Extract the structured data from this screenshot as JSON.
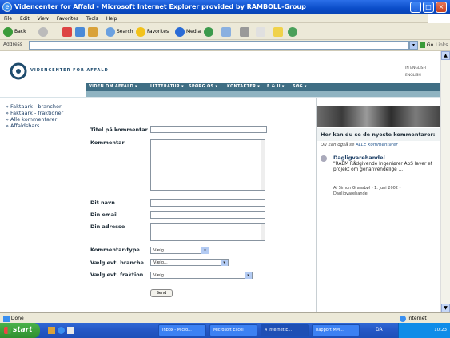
{
  "window": {
    "title": "Videncenter for Affald - Microsoft Internet Explorer provided by RAMBOLL-Group"
  },
  "menu": [
    "File",
    "Edit",
    "View",
    "Favorites",
    "Tools",
    "Help"
  ],
  "toolbar": {
    "back": "Back",
    "search": "Search",
    "favorites": "Favorites",
    "media": "Media"
  },
  "address": {
    "label": "Address",
    "go": "Go",
    "links": "Links"
  },
  "site": {
    "logo_text": "VIDENCENTER FOR AFFALD",
    "lang": [
      "IN ENGLISH",
      "ENGLISH"
    ],
    "nav": [
      "VIDEN OM AFFALD ▾",
      "LITTERATUR ▾",
      "SPØRG OS ▾",
      "KONTAKTER ▾",
      "F & U ▾",
      "SØG ▾"
    ],
    "sidebar": [
      "» Faktaark - brancher",
      "» Faktaark - fraktioner",
      "» Alle kommentarer",
      "» Affaldsbars"
    ]
  },
  "form": {
    "title_label": "Titel på kommentar",
    "comment_label": "Kommentar",
    "name_label": "Dit navn",
    "email_label": "Din email",
    "address_label": "Din adresse",
    "type_label": "Kommentar-type",
    "type_value": "Vælg",
    "branch_label": "Vælg evt. branche",
    "branch_value": "Vælg...",
    "fraction_label": "Vælg evt. fraktion",
    "fraction_value": "Vælg...",
    "send": "Send"
  },
  "right": {
    "heading": "Her kan du se de nyeste kommentarer:",
    "see_prefix": "Du kan også se",
    "see_link": "ALLE kommentarer",
    "item_title": "Dagligvarehandel",
    "item_body": "\"RAEM Rådgivende Ingeniører ApS laver et projekt om genanvendelige ...",
    "item_meta1": "Af Simon Graasbøl - 1. Juni 2002 -",
    "item_meta2": "Dagligvarehandel"
  },
  "status": {
    "left": "Done",
    "right": "Internet"
  },
  "taskbar": {
    "start": "start",
    "items": [
      "Inbox - Micro...",
      "Microsoft Excel",
      "4 Internet E...",
      "Rapport MM..."
    ],
    "lang": "DA",
    "clock": "10:23"
  }
}
